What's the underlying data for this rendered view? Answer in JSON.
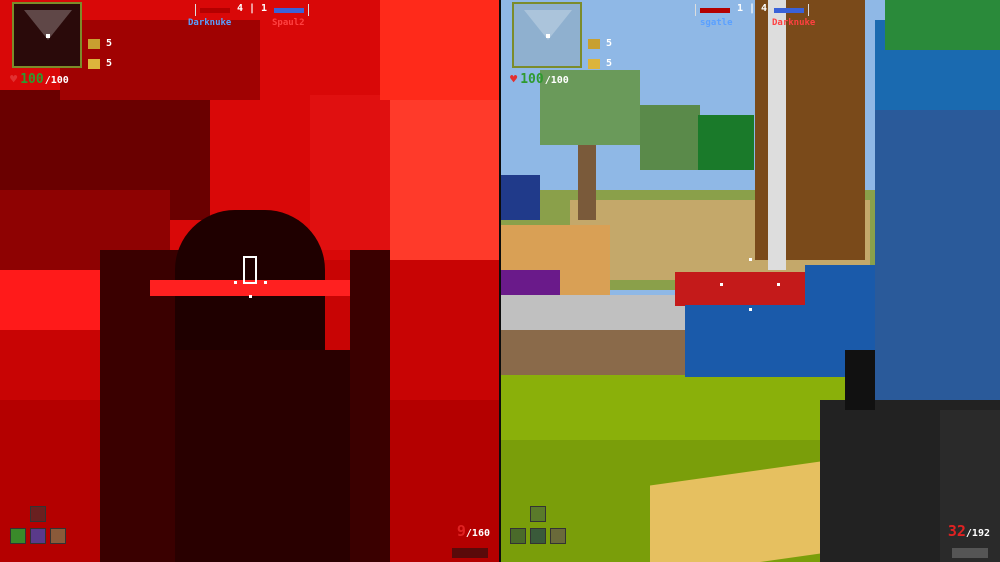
{
  "left_player": {
    "score": "4 | 1",
    "team_blue_name": "Darknuke",
    "team_red_name": "Spaul2",
    "stat1_value": "5",
    "stat2_value": "5",
    "health_value": "100",
    "health_max": "/100",
    "ammo_clip": "9",
    "ammo_reserve": "/160",
    "status_tint": "#d90808"
  },
  "right_player": {
    "score": "1 | 4",
    "team_blue_name": "sgatle",
    "team_red_name": "Darknuke",
    "stat1_value": "5",
    "stat2_value": "5",
    "health_value": "100",
    "health_max": "/100",
    "ammo_clip": "32",
    "ammo_reserve": "/192"
  },
  "icons": {
    "heart": "heart-icon",
    "stat1": "bomb-icon",
    "stat2": "grenade-icon",
    "weapon": "rifle-icon"
  },
  "colors": {
    "health_green": "#2f9a2f",
    "blue_team": "#5aa0ff",
    "red_team": "#ff4040",
    "ammo_red": "#e02222",
    "minimap_border": "#7c8c2a"
  }
}
